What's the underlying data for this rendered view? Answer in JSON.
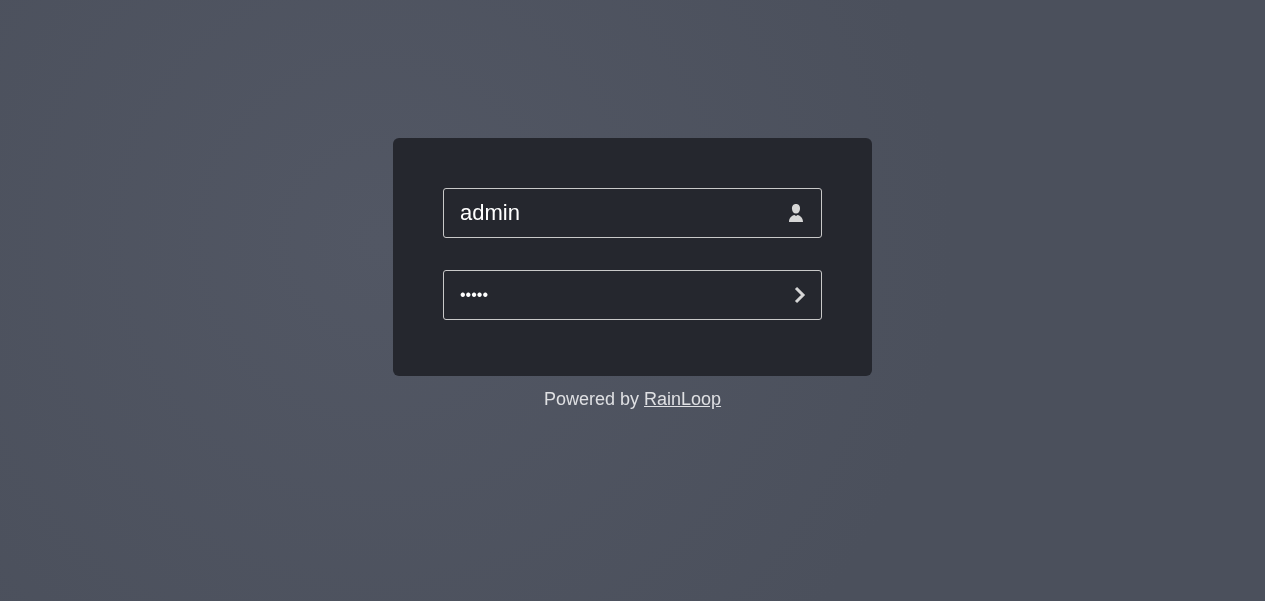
{
  "login_form": {
    "fields": [
      {
        "kind": "login",
        "value": "admin"
      },
      {
        "kind": "password",
        "value": "•••••"
      }
    ]
  },
  "footer": {
    "text": "Powered by",
    "link": "RainLoop"
  }
}
